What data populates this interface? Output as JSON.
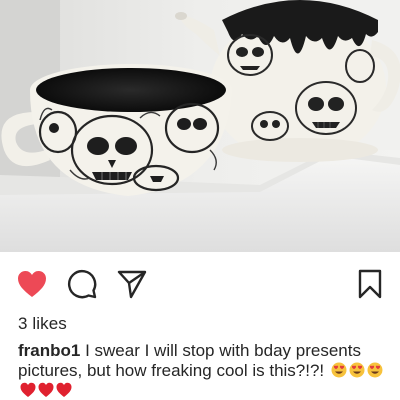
{
  "post": {
    "photo_alt": "",
    "likes_text": "3 likes",
    "username": "franbo1",
    "caption_text": "I swear I will stop with bday presents pictures, but how freaking cool is this?!?!",
    "emojis": [
      "heart-eyes-emoji",
      "heart-eyes-emoji",
      "heart-eyes-emoji",
      "red-heart-emoji",
      "red-heart-emoji",
      "red-heart-emoji"
    ]
  },
  "actions": {
    "like_icon": "heart-icon",
    "like_color": "#ed4956",
    "comment_icon": "comment-icon",
    "share_icon": "share-icon",
    "save_icon": "bookmark-icon"
  }
}
